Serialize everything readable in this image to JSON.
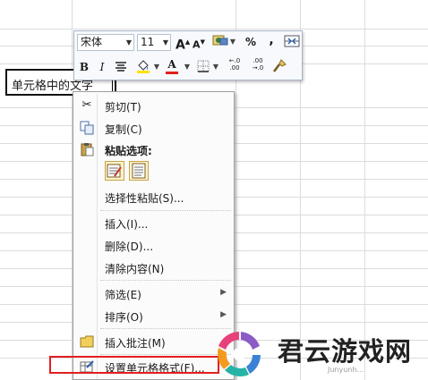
{
  "cell": {
    "text": "单元格中的文字"
  },
  "mini_toolbar": {
    "font_name": "宋体",
    "font_size": "11",
    "grow_font": "A",
    "shrink_font": "A",
    "percent": "%",
    "comma": ",",
    "bold": "B",
    "italic": "I",
    "font_color": "A",
    "inc_decimal": "←.0 .00",
    "dec_decimal": ".00 →.0"
  },
  "context_menu": {
    "items": [
      {
        "label": "剪切(T)",
        "icon": "scissors-icon"
      },
      {
        "label": "复制(C)",
        "icon": "copy-icon"
      },
      {
        "label": "粘贴选项:",
        "icon": "clipboard-icon"
      },
      {
        "label": "选择性粘贴(S)...",
        "icon": ""
      },
      {
        "label": "插入(I)...",
        "icon": ""
      },
      {
        "label": "删除(D)...",
        "icon": ""
      },
      {
        "label": "清除内容(N)",
        "icon": ""
      },
      {
        "label": "筛选(E)",
        "icon": "",
        "submenu": true
      },
      {
        "label": "排序(O)",
        "icon": "",
        "submenu": true
      },
      {
        "label": "插入批注(M)",
        "icon": "comment-icon"
      },
      {
        "label": "设置单元格格式(F)...",
        "icon": "format-cells-icon"
      }
    ]
  },
  "watermark": {
    "name": "君云游戏网",
    "url": "Junyunh..."
  },
  "colors": {
    "highlight": "#e21f1f",
    "menu_bg": "#fbfbfb",
    "toolbar_bg": "#f7f9fc"
  }
}
